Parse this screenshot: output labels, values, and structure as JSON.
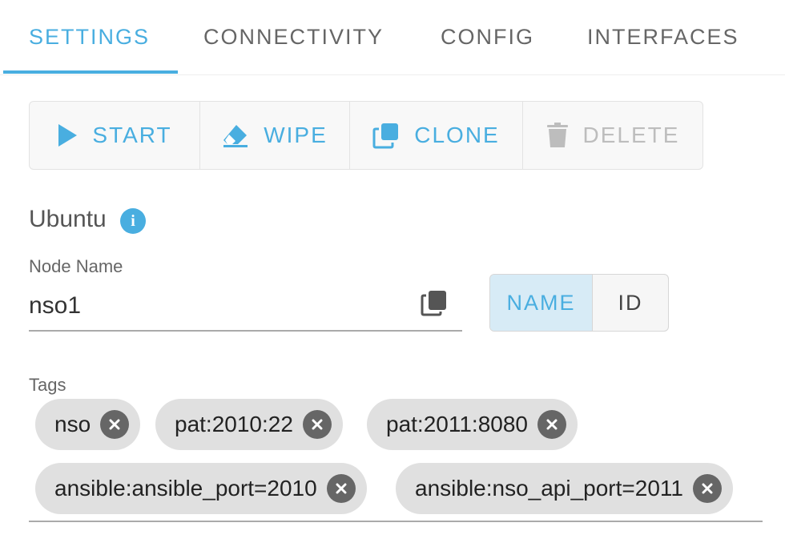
{
  "tabs": [
    {
      "label": "SETTINGS",
      "active": true
    },
    {
      "label": "CONNECTIVITY",
      "active": false
    },
    {
      "label": "CONFIG",
      "active": false
    },
    {
      "label": "INTERFACES",
      "active": false
    }
  ],
  "actions": {
    "start": {
      "label": "START",
      "icon": "play-icon"
    },
    "wipe": {
      "label": "WIPE",
      "icon": "eraser-icon"
    },
    "clone": {
      "label": "CLONE",
      "icon": "clone-icon"
    },
    "delete": {
      "label": "DELETE",
      "icon": "trash-icon",
      "disabled": true
    }
  },
  "node": {
    "image_definition": "Ubuntu",
    "name_label": "Node Name",
    "name_value": "nso1"
  },
  "display_toggle": {
    "name_label": "NAME",
    "id_label": "ID",
    "selected": "NAME"
  },
  "tags": {
    "label": "Tags",
    "items": [
      "nso",
      "pat:2010:22",
      "pat:2011:8080",
      "ansible:ansible_port=2010",
      "ansible:nso_api_port=2011"
    ]
  },
  "colors": {
    "accent": "#49aee0",
    "chip_bg": "#e0e0e0",
    "disabled": "#bdbdbd"
  }
}
